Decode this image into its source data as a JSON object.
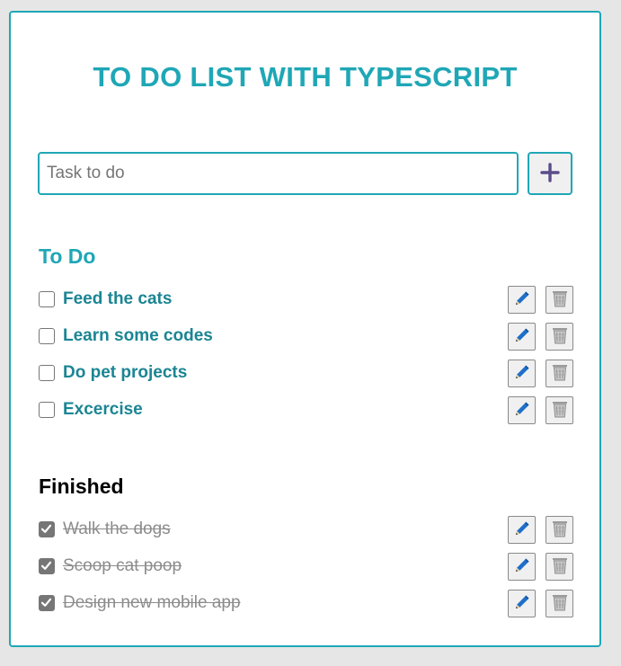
{
  "title": "TO DO LIST WITH TYPESCRIPT",
  "new_task": {
    "placeholder": "Task to do",
    "value": "",
    "add_icon": "plus-icon"
  },
  "todo": {
    "heading": "To Do",
    "items": [
      {
        "label": "Feed the cats",
        "checked": false
      },
      {
        "label": "Learn some codes",
        "checked": false
      },
      {
        "label": "Do pet projects",
        "checked": false
      },
      {
        "label": "Excercise",
        "checked": false
      }
    ]
  },
  "finished": {
    "heading": "Finished",
    "items": [
      {
        "label": "Walk the dogs",
        "checked": true
      },
      {
        "label": "Scoop cat poop",
        "checked": true
      },
      {
        "label": "Design new mobile app",
        "checked": true
      }
    ]
  },
  "icons": {
    "edit": "pencil-icon",
    "delete": "trash-icon",
    "check": "checkmark-icon"
  },
  "colors": {
    "accent": "#1fa7b6",
    "todo_text": "#1b8593",
    "finished_text": "#8c8c8c",
    "plus": "#5b4b8a",
    "pencil": "#1f6fc9"
  }
}
